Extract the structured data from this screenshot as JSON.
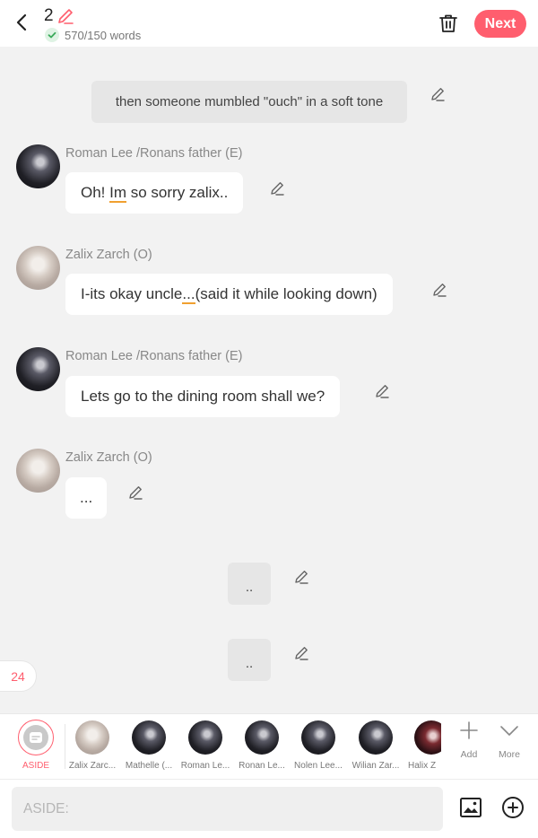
{
  "header": {
    "chapter_number": "2",
    "word_count": "570/150 words",
    "next_label": "Next"
  },
  "messages": [
    {
      "type": "aside",
      "text": "then someone mumbled \"ouch\" in a soft tone"
    },
    {
      "type": "character",
      "name": "Roman Lee /Ronans father (E)",
      "pre": "Oh! ",
      "underlined": "Im",
      "post": " so sorry zalix..",
      "avatar": "dark"
    },
    {
      "type": "character",
      "name": "Zalix Zarch (O)",
      "pre": "I-its okay uncle",
      "underlined": "...",
      "post": "(said it while looking down)",
      "avatar": "light"
    },
    {
      "type": "character",
      "name": "Roman Lee /Ronans father (E)",
      "text": "Lets go to the dining room shall we?",
      "avatar": "dark"
    },
    {
      "type": "character",
      "name": "Zalix Zarch (O)",
      "text": "...",
      "avatar": "light"
    },
    {
      "type": "aside",
      "text": ".."
    },
    {
      "type": "aside",
      "text": ".."
    }
  ],
  "page_badge": "24",
  "characters": {
    "aside_label": "ASIDE",
    "list": [
      {
        "name": "Zalix Zarc...",
        "avatar": "light"
      },
      {
        "name": "Mathelle (...",
        "avatar": "dark"
      },
      {
        "name": "Roman Le...",
        "avatar": "dark"
      },
      {
        "name": "Ronan Le...",
        "avatar": "dark"
      },
      {
        "name": "Nolen Lee...",
        "avatar": "dark"
      },
      {
        "name": "Wilian Zar...",
        "avatar": "dark"
      },
      {
        "name": "Halix Z",
        "avatar": "dark"
      }
    ],
    "add_label": "Add",
    "more_label": "More"
  },
  "input": {
    "placeholder": "ASIDE:"
  },
  "colors": {
    "accent": "#ff5e6e",
    "background": "#f2f2f2",
    "aside_bubble": "#e6e6e6",
    "char_bubble": "#ffffff"
  }
}
